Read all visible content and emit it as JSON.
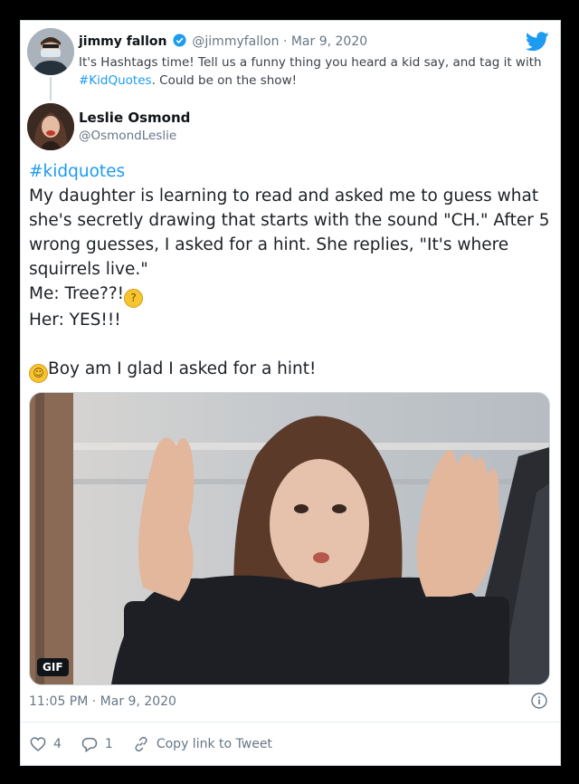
{
  "parent_tweet": {
    "author_name": "jimmy fallon",
    "author_handle": "@jimmyfallon",
    "separator": "·",
    "date": "Mar 9, 2020",
    "text_pre": "It's Hashtags time! Tell us a funny thing you heard a kid say, and tag it with ",
    "hashtag": "#KidQuotes",
    "text_post": ". Could be on the show!",
    "avatar_icon": "jimmy-fallon-avatar"
  },
  "tweet": {
    "author_name": "Leslie Osmond",
    "author_handle": "@OsmondLeslie",
    "hashtag": "#kidquotes",
    "lines": [
      "My daughter is learning to read and asked me to guess what",
      "she's secretly drawing that starts with the sound \"CH.\" After 5",
      "wrong guesses, I asked for a hint. She replies, \"It's where",
      "squirrels live.\""
    ],
    "me_line": "Me: Tree??!",
    "her_line": "Her: YES!!!",
    "final_line": "Boy am I glad I asked for a hint!",
    "emoji_thinking": "thinking-face",
    "emoji_laughing": "rolling-on-floor-laughing",
    "media_badge": "GIF",
    "timestamp": "11:05 PM · Mar 9, 2020"
  },
  "actions": {
    "likes": "4",
    "replies": "1",
    "copy_link": "Copy link to Tweet"
  },
  "colors": {
    "twitter_blue": "#1d9bf0",
    "text": "#0f1419",
    "muted": "#657786",
    "frame": "#000000"
  }
}
